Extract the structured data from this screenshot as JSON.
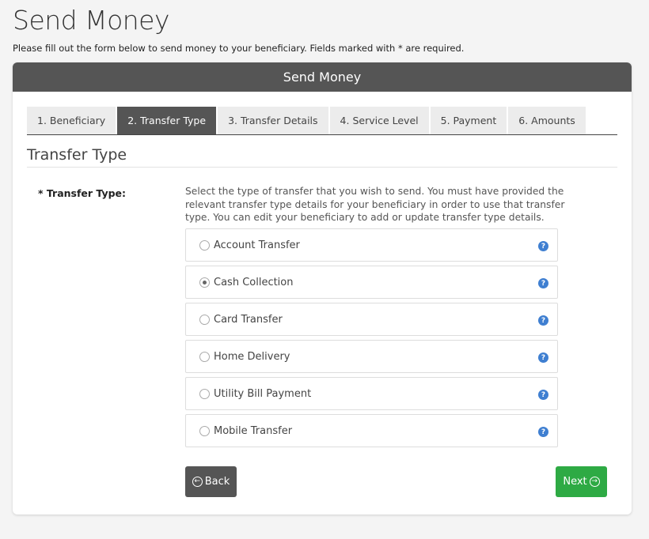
{
  "page": {
    "title": "Send Money",
    "intro": "Please fill out the form below to send money to your beneficiary. Fields marked with * are required."
  },
  "card": {
    "header": "Send Money"
  },
  "tabs": [
    {
      "label": "1. Beneficiary",
      "active": false
    },
    {
      "label": "2. Transfer Type",
      "active": true
    },
    {
      "label": "3. Transfer Details",
      "active": false
    },
    {
      "label": "4. Service Level",
      "active": false
    },
    {
      "label": "5. Payment",
      "active": false
    },
    {
      "label": "6. Amounts",
      "active": false
    }
  ],
  "section": {
    "title": "Transfer Type"
  },
  "field": {
    "label": "* Transfer Type:",
    "help": "Select the type of transfer that you wish to send. You must have provided the relevant transfer type details for your beneficiary in order to use that transfer type. You can edit your beneficiary to add or update transfer type details."
  },
  "options": [
    {
      "label": "Account Transfer",
      "selected": false
    },
    {
      "label": "Cash Collection",
      "selected": true
    },
    {
      "label": "Card Transfer",
      "selected": false
    },
    {
      "label": "Home Delivery",
      "selected": false
    },
    {
      "label": "Utility Bill Payment",
      "selected": false
    },
    {
      "label": "Mobile Transfer",
      "selected": false
    }
  ],
  "help_icon_glyph": "?",
  "buttons": {
    "back": "Back",
    "back_icon": "←",
    "next": "Next",
    "next_icon": "→"
  },
  "colors": {
    "header_bg": "#555555",
    "active_tab": "#555555",
    "next_button": "#2eaa44",
    "help_icon": "#3f7fd1"
  }
}
